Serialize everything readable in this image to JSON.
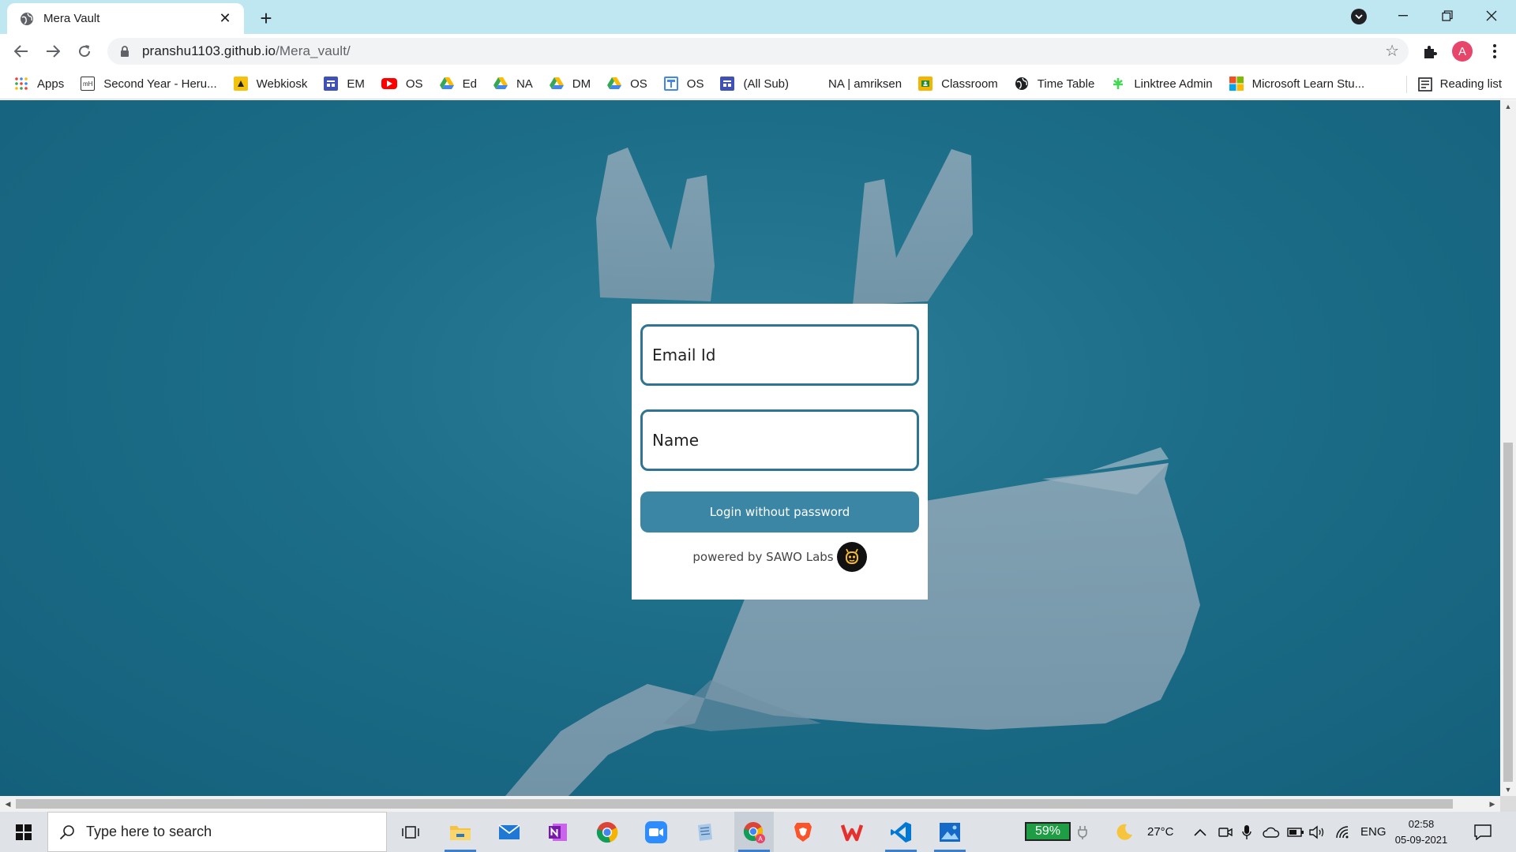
{
  "browser": {
    "tab_title": "Mera Vault",
    "url_host": "pranshu1103.github.io",
    "url_path": "/Mera_vault/",
    "profile_initial": "A",
    "new_tab_symbol": "+",
    "close_symbol": "✕"
  },
  "bookmarks": {
    "items": [
      {
        "label": "Apps",
        "icon": "apps-grid-icon"
      },
      {
        "label": "Second Year - Heru...",
        "icon": "mh-icon"
      },
      {
        "label": "Webkiosk",
        "icon": "webkiosk-icon"
      },
      {
        "label": "EM",
        "icon": "forms-icon"
      },
      {
        "label": "OS",
        "icon": "youtube-icon"
      },
      {
        "label": "Ed",
        "icon": "drive-icon"
      },
      {
        "label": "NA",
        "icon": "drive-icon"
      },
      {
        "label": "DM",
        "icon": "drive-icon"
      },
      {
        "label": "OS",
        "icon": "drive-icon"
      },
      {
        "label": "OS",
        "icon": "forms-icon"
      },
      {
        "label": "(All Sub)",
        "icon": "forms-icon"
      },
      {
        "label": "NA | amriksen",
        "icon": "none"
      },
      {
        "label": "Classroom",
        "icon": "classroom-icon"
      },
      {
        "label": "Time Table",
        "icon": "globe-icon"
      },
      {
        "label": "Linktree Admin",
        "icon": "linktree-icon"
      },
      {
        "label": "Microsoft Learn Stu...",
        "icon": "microsoft-icon"
      }
    ],
    "reading_list": "Reading list"
  },
  "login": {
    "email_placeholder": "Email Id",
    "name_placeholder": "Name",
    "button_label": "Login without password",
    "powered_by": "powered by SAWO Labs"
  },
  "taskbar": {
    "search_placeholder": "Type here to search",
    "battery": "59%",
    "temperature": "27°C",
    "language": "ENG",
    "time": "02:58",
    "date": "05-09-2021"
  },
  "colors": {
    "accent": "#3b86a5",
    "field_border": "#2f7493",
    "background": "#1c6d88",
    "tabstrip": "#bfe7f2"
  }
}
